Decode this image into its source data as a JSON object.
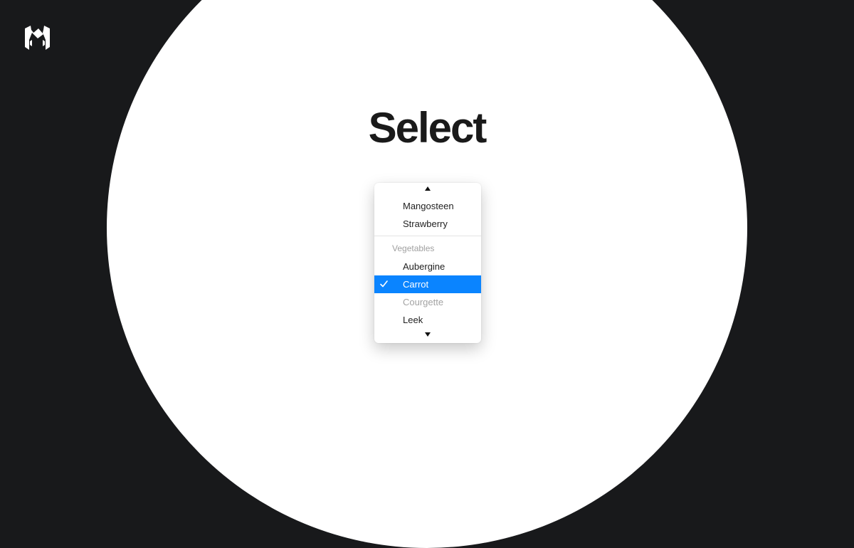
{
  "brand": {
    "logo_icon": "brand-logo-icon",
    "logo_color": "#ffffff"
  },
  "page": {
    "title": "Select",
    "background_color": "#18191b",
    "circle_color": "#ffffff"
  },
  "select_menu": {
    "scroll_up_icon": "triangle-up-icon",
    "scroll_down_icon": "triangle-down-icon",
    "accent_color": "#0a84ff",
    "options_before": [
      {
        "label": "Mangosteen"
      },
      {
        "label": "Strawberry"
      }
    ],
    "group": {
      "label": "Vegetables",
      "options": [
        {
          "label": "Aubergine",
          "disabled": false,
          "selected": false
        },
        {
          "label": "Carrot",
          "disabled": false,
          "selected": true,
          "check_icon": "checkmark-icon"
        },
        {
          "label": "Courgette",
          "disabled": true,
          "selected": false
        },
        {
          "label": "Leek",
          "disabled": false,
          "selected": false
        }
      ]
    }
  }
}
